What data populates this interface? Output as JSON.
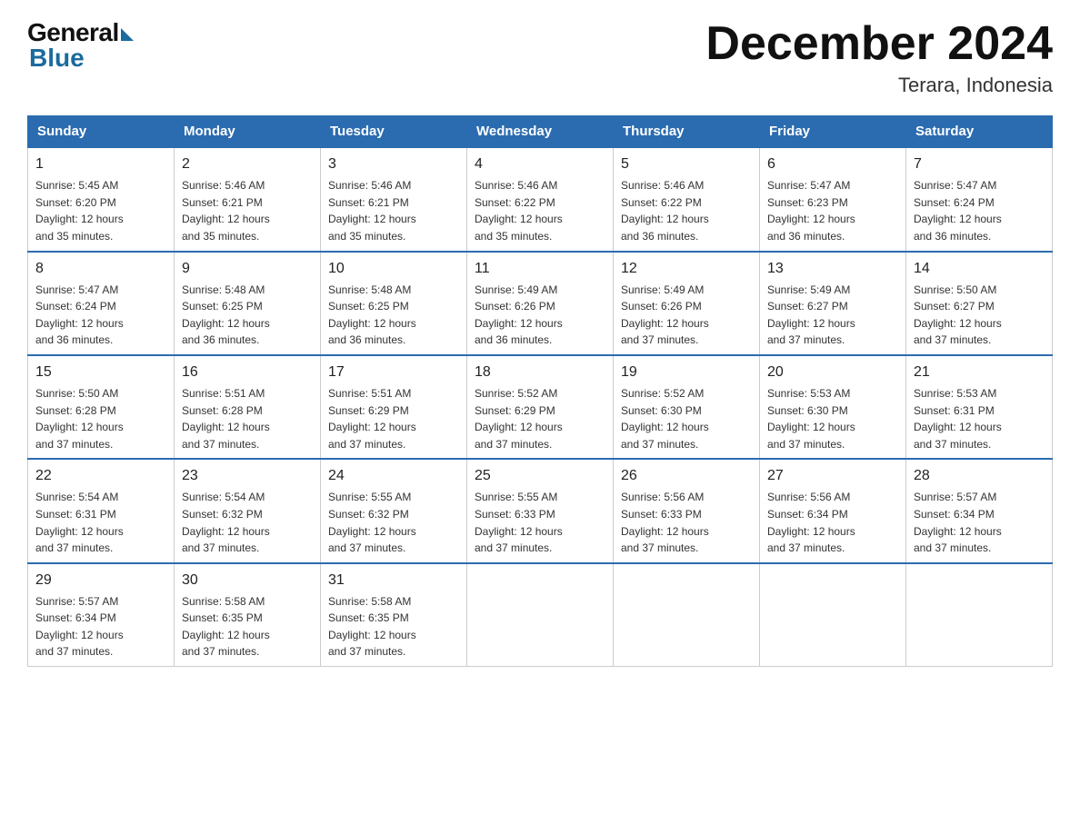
{
  "logo": {
    "general": "General",
    "blue": "Blue"
  },
  "title": {
    "month": "December 2024",
    "location": "Terara, Indonesia"
  },
  "headers": [
    "Sunday",
    "Monday",
    "Tuesday",
    "Wednesday",
    "Thursday",
    "Friday",
    "Saturday"
  ],
  "weeks": [
    [
      {
        "day": "1",
        "sunrise": "5:45 AM",
        "sunset": "6:20 PM",
        "daylight": "12 hours and 35 minutes."
      },
      {
        "day": "2",
        "sunrise": "5:46 AM",
        "sunset": "6:21 PM",
        "daylight": "12 hours and 35 minutes."
      },
      {
        "day": "3",
        "sunrise": "5:46 AM",
        "sunset": "6:21 PM",
        "daylight": "12 hours and 35 minutes."
      },
      {
        "day": "4",
        "sunrise": "5:46 AM",
        "sunset": "6:22 PM",
        "daylight": "12 hours and 35 minutes."
      },
      {
        "day": "5",
        "sunrise": "5:46 AM",
        "sunset": "6:22 PM",
        "daylight": "12 hours and 36 minutes."
      },
      {
        "day": "6",
        "sunrise": "5:47 AM",
        "sunset": "6:23 PM",
        "daylight": "12 hours and 36 minutes."
      },
      {
        "day": "7",
        "sunrise": "5:47 AM",
        "sunset": "6:24 PM",
        "daylight": "12 hours and 36 minutes."
      }
    ],
    [
      {
        "day": "8",
        "sunrise": "5:47 AM",
        "sunset": "6:24 PM",
        "daylight": "12 hours and 36 minutes."
      },
      {
        "day": "9",
        "sunrise": "5:48 AM",
        "sunset": "6:25 PM",
        "daylight": "12 hours and 36 minutes."
      },
      {
        "day": "10",
        "sunrise": "5:48 AM",
        "sunset": "6:25 PM",
        "daylight": "12 hours and 36 minutes."
      },
      {
        "day": "11",
        "sunrise": "5:49 AM",
        "sunset": "6:26 PM",
        "daylight": "12 hours and 36 minutes."
      },
      {
        "day": "12",
        "sunrise": "5:49 AM",
        "sunset": "6:26 PM",
        "daylight": "12 hours and 37 minutes."
      },
      {
        "day": "13",
        "sunrise": "5:49 AM",
        "sunset": "6:27 PM",
        "daylight": "12 hours and 37 minutes."
      },
      {
        "day": "14",
        "sunrise": "5:50 AM",
        "sunset": "6:27 PM",
        "daylight": "12 hours and 37 minutes."
      }
    ],
    [
      {
        "day": "15",
        "sunrise": "5:50 AM",
        "sunset": "6:28 PM",
        "daylight": "12 hours and 37 minutes."
      },
      {
        "day": "16",
        "sunrise": "5:51 AM",
        "sunset": "6:28 PM",
        "daylight": "12 hours and 37 minutes."
      },
      {
        "day": "17",
        "sunrise": "5:51 AM",
        "sunset": "6:29 PM",
        "daylight": "12 hours and 37 minutes."
      },
      {
        "day": "18",
        "sunrise": "5:52 AM",
        "sunset": "6:29 PM",
        "daylight": "12 hours and 37 minutes."
      },
      {
        "day": "19",
        "sunrise": "5:52 AM",
        "sunset": "6:30 PM",
        "daylight": "12 hours and 37 minutes."
      },
      {
        "day": "20",
        "sunrise": "5:53 AM",
        "sunset": "6:30 PM",
        "daylight": "12 hours and 37 minutes."
      },
      {
        "day": "21",
        "sunrise": "5:53 AM",
        "sunset": "6:31 PM",
        "daylight": "12 hours and 37 minutes."
      }
    ],
    [
      {
        "day": "22",
        "sunrise": "5:54 AM",
        "sunset": "6:31 PM",
        "daylight": "12 hours and 37 minutes."
      },
      {
        "day": "23",
        "sunrise": "5:54 AM",
        "sunset": "6:32 PM",
        "daylight": "12 hours and 37 minutes."
      },
      {
        "day": "24",
        "sunrise": "5:55 AM",
        "sunset": "6:32 PM",
        "daylight": "12 hours and 37 minutes."
      },
      {
        "day": "25",
        "sunrise": "5:55 AM",
        "sunset": "6:33 PM",
        "daylight": "12 hours and 37 minutes."
      },
      {
        "day": "26",
        "sunrise": "5:56 AM",
        "sunset": "6:33 PM",
        "daylight": "12 hours and 37 minutes."
      },
      {
        "day": "27",
        "sunrise": "5:56 AM",
        "sunset": "6:34 PM",
        "daylight": "12 hours and 37 minutes."
      },
      {
        "day": "28",
        "sunrise": "5:57 AM",
        "sunset": "6:34 PM",
        "daylight": "12 hours and 37 minutes."
      }
    ],
    [
      {
        "day": "29",
        "sunrise": "5:57 AM",
        "sunset": "6:34 PM",
        "daylight": "12 hours and 37 minutes."
      },
      {
        "day": "30",
        "sunrise": "5:58 AM",
        "sunset": "6:35 PM",
        "daylight": "12 hours and 37 minutes."
      },
      {
        "day": "31",
        "sunrise": "5:58 AM",
        "sunset": "6:35 PM",
        "daylight": "12 hours and 37 minutes."
      },
      null,
      null,
      null,
      null
    ]
  ],
  "labels": {
    "sunrise": "Sunrise:",
    "sunset": "Sunset:",
    "daylight": "Daylight:"
  }
}
